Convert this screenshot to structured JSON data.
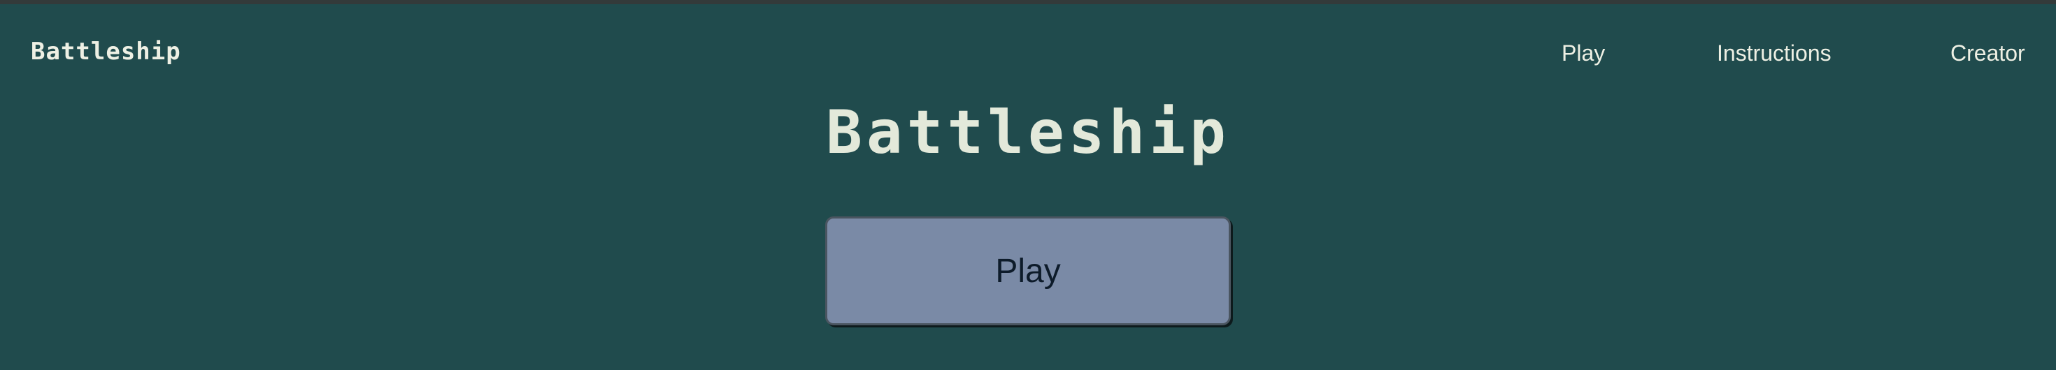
{
  "navbar": {
    "brand": "Battleship",
    "links": [
      {
        "label": "Play"
      },
      {
        "label": "Instructions"
      },
      {
        "label": "Creator"
      }
    ]
  },
  "main": {
    "title": "Battleship",
    "play_button_label": "Play"
  },
  "colors": {
    "background": "#204b4d",
    "text": "#eef0e4",
    "button_background": "#7a8aa6",
    "button_text": "#0d1b2a"
  }
}
